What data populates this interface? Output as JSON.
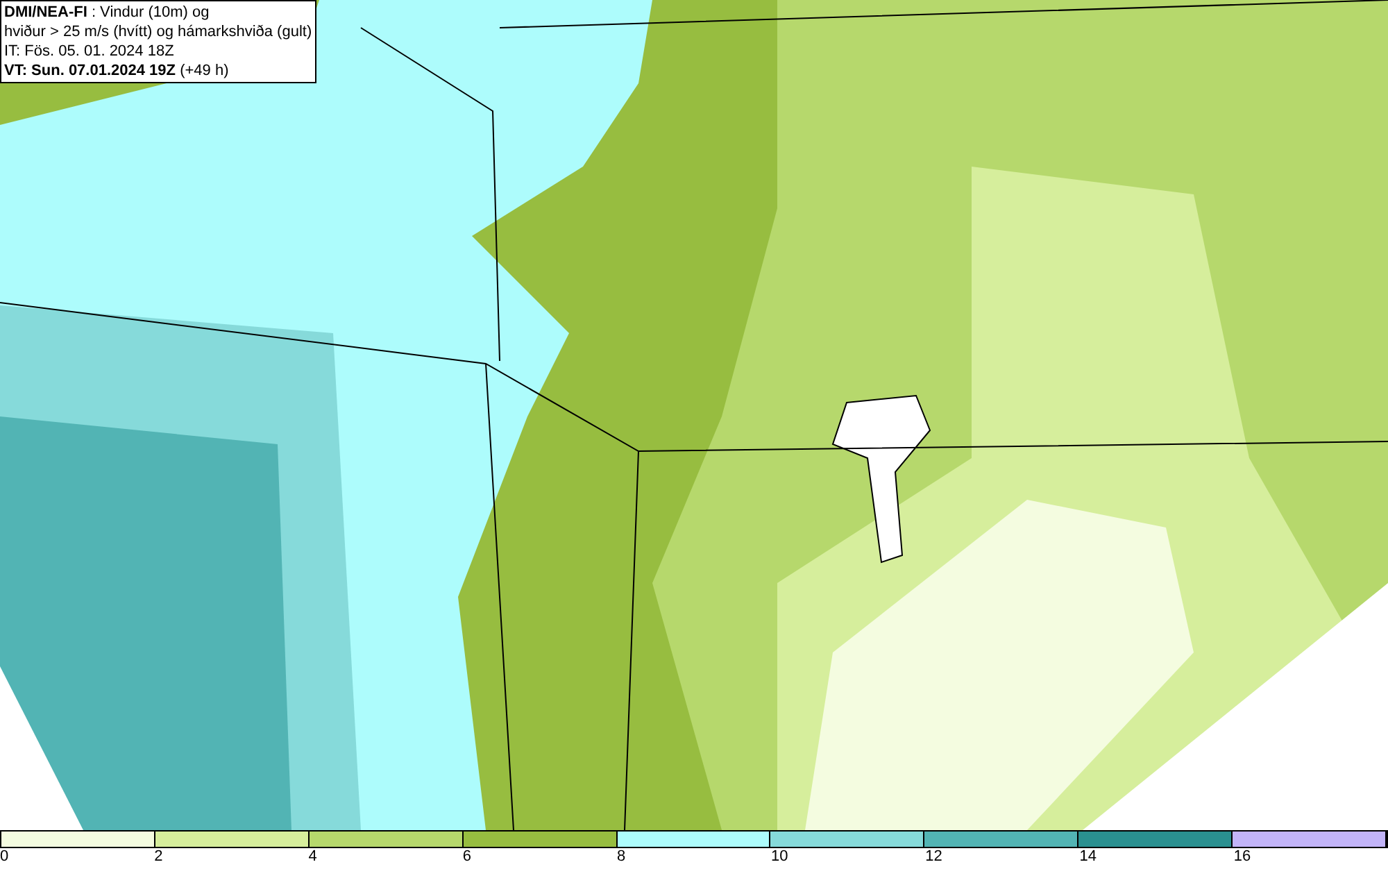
{
  "info_box": {
    "lines": [
      "**DMI/NEA-FI** : Vindur (10m) og",
      "hviður > 25 m/s (hvítt) og hámarkshviða (gult)",
      "IT: Fös. 05. 01. 2024 18Z",
      "**VT: Sun. 07.01.2024 19Z** (+49 h)"
    ]
  },
  "legend": {
    "segments": [
      {
        "label": "0",
        "color": "#f4fce0"
      },
      {
        "label": "2",
        "color": "#d6ee9c"
      },
      {
        "label": "4",
        "color": "#b6d86c"
      },
      {
        "label": "6",
        "color": "#97bd40"
      },
      {
        "label": "8",
        "color": "#adfcfc"
      },
      {
        "label": "10",
        "color": "#86dada"
      },
      {
        "label": "12",
        "color": "#52b4b4"
      },
      {
        "label": "14",
        "color": "#2a9090"
      },
      {
        "label": "16",
        "color": "#c2b4f8"
      }
    ]
  }
}
